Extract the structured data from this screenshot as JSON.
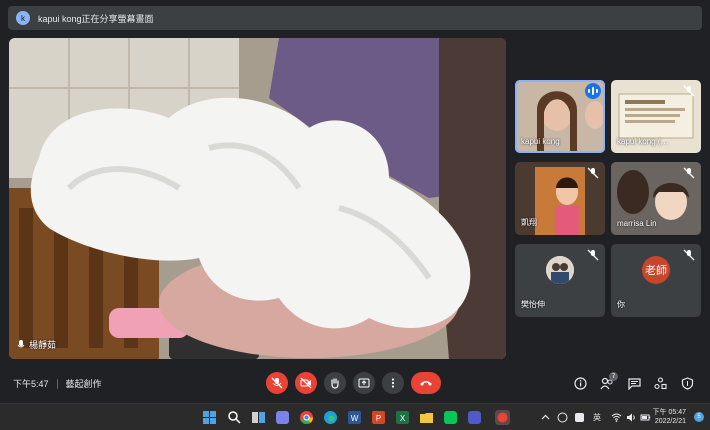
{
  "banner": {
    "avatar_letter": "k",
    "text": "kapui kong正在分享螢幕畫面"
  },
  "main_video": {
    "presenter_name": "楊靜茹"
  },
  "tiles": [
    {
      "label": "kapui kong",
      "speaking": true
    },
    {
      "label": "kapui kong (…",
      "muted": true
    },
    {
      "label": "凱翔",
      "muted": true
    },
    {
      "label": "marrisa Lin",
      "muted": true
    },
    {
      "label": "樊怡伸",
      "muted": true
    },
    {
      "label": "你",
      "avatar_text": "老師",
      "muted": true
    }
  ],
  "controls": {
    "time": "下午5:47",
    "meeting_name": "藝起創作",
    "participants_count": "7"
  },
  "taskbar": {
    "tray_lang": "英",
    "clock_time": "下午 05:47",
    "clock_date": "2022/2/21",
    "notification_count": "5"
  },
  "colors": {
    "background": "#202124",
    "accent": "#8ab4f8",
    "danger": "#ea4335",
    "control_bg": "#3c4043",
    "teacher_avatar": "#c5462b"
  }
}
